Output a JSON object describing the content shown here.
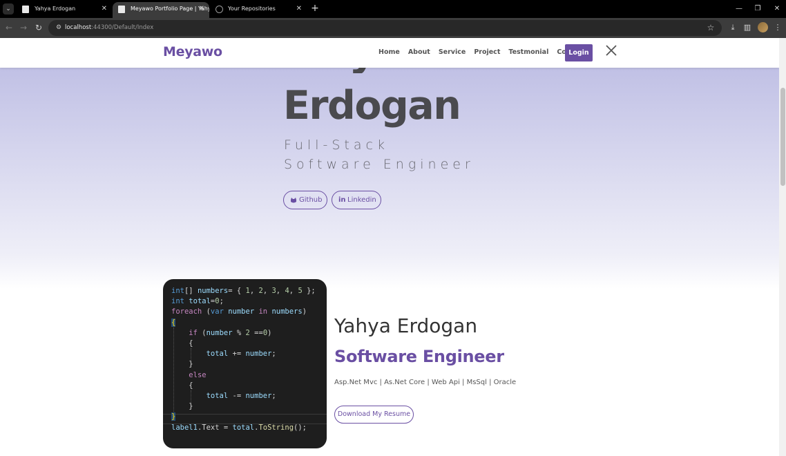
{
  "browser": {
    "tabs": [
      {
        "title": "Yahya Erdogan",
        "active": false
      },
      {
        "title": "Meyawo Portfolio Page | Yahya",
        "active": true
      },
      {
        "title": "Your Repositories",
        "active": false
      }
    ],
    "url_host": "localhost",
    "url_rest": ":44300/Default/Index",
    "icons": {
      "tab_list": "chevron-down",
      "back": "arrow-left",
      "forward": "arrow-right",
      "reload": "reload",
      "site_info": "tune",
      "bookmark": "star",
      "download": "download",
      "sidebar": "side-panel",
      "menu": "more-vertical"
    }
  },
  "site": {
    "brand": "Meyawo",
    "nav": [
      "Home",
      "About",
      "Service",
      "Project",
      "Testmonial",
      "Contact"
    ],
    "login": "Login",
    "accent": "#6a4fa3"
  },
  "hero": {
    "last_name": "Erdogan",
    "subtitle": "Full-Stack Software Engineer",
    "buttons": [
      {
        "label": "Github",
        "icon": "github-icon"
      },
      {
        "label": "Linkedin",
        "icon": "linkedin-icon"
      }
    ]
  },
  "about": {
    "name": "Yahya Erdogan",
    "role": "Software Engineer",
    "skills": "Asp.Net Mvc | As.Net Core | Web Api | MsSql | Oracle",
    "resume_button": "Download My Resume",
    "code_lines": [
      "int[] numbers= { 1, 2, 3, 4, 5 };",
      "int total=0;",
      "foreach (var number in numbers)",
      "{",
      "    if (number % 2 ==0)",
      "    {",
      "        total += number;",
      "    }",
      "    else",
      "    {",
      "        total -= number;",
      "    }",
      "}",
      "label1.Text = total.ToString();"
    ]
  }
}
